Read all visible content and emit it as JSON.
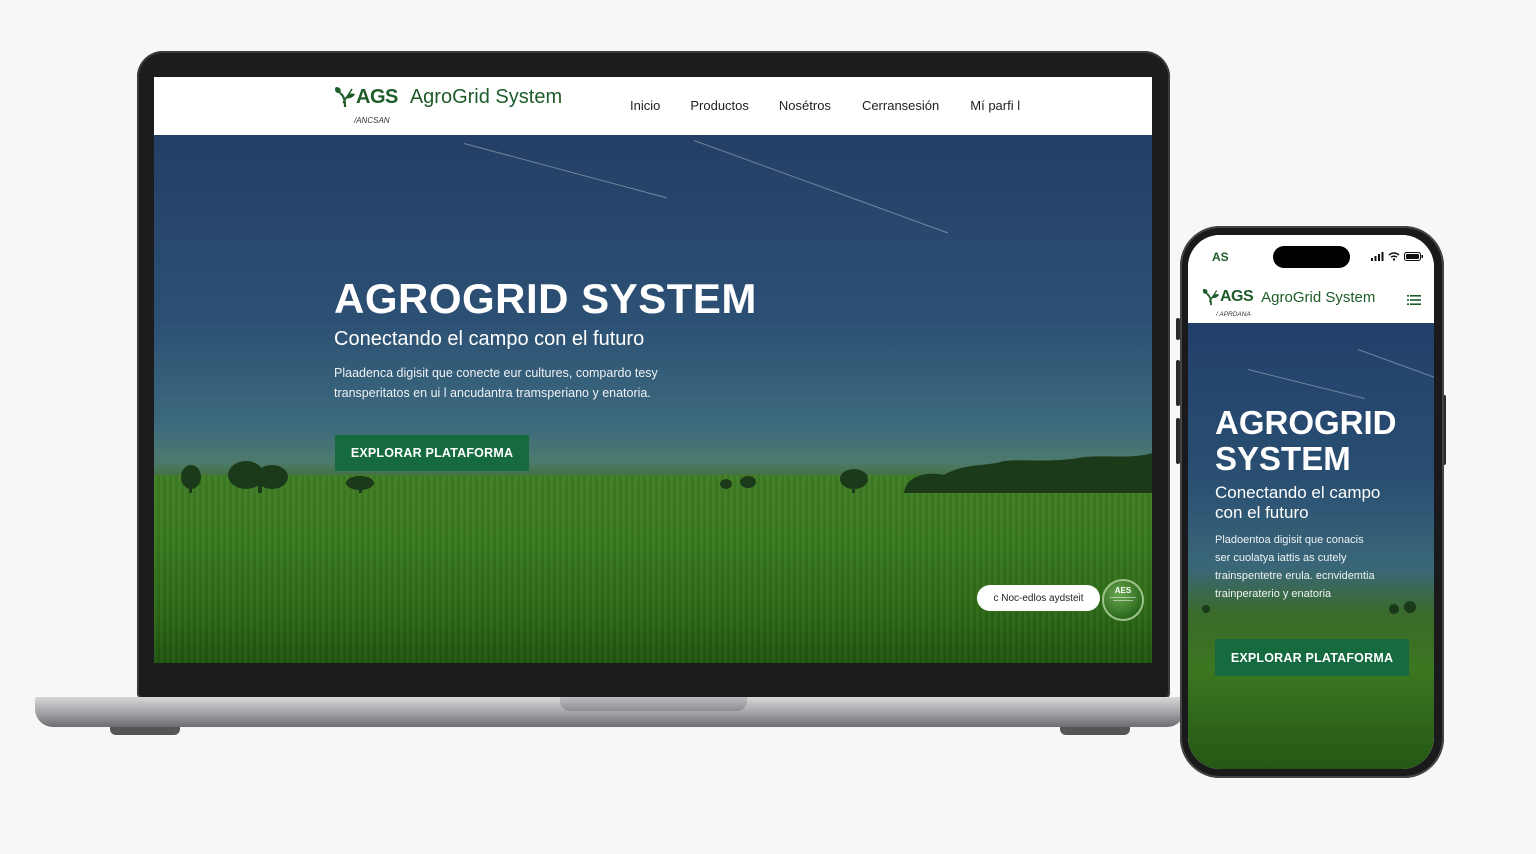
{
  "brand": {
    "abbr": "AGS",
    "name": "AgroGrid System",
    "tagline_desktop": "/ANCSAN",
    "tagline_mobile": "/ APRDANA"
  },
  "desktop": {
    "nav": [
      "Inicio",
      "Productos",
      "Nosétros",
      "Cerransesión",
      "Mí parfi l"
    ],
    "hero": {
      "title": "AGROGRID SYSTEM",
      "subtitle": "Conectando el campo con el futuro",
      "description_line1": "Plaadenca digisit que conecte eur cultures, compardo tesy",
      "description_line2": "transperitatos en ui l ancudantra tramsperiano y enatoria.",
      "cta": "EXPLORAR PLATAFORMA"
    },
    "chip": "c Noc-edlos aydsteit",
    "badge": "AES"
  },
  "mobile": {
    "status_left": "AS",
    "hero": {
      "title_line1": "AGROGRID",
      "title_line2": "SYSTEM",
      "subtitle_line1": "Conectando el campo",
      "subtitle_line2": "con el futuro",
      "description_line1": "Pladoentoa digisit que conacis",
      "description_line2": "ser cuolatya iattis as cutely",
      "description_line3": "trainspentetre erula. ecnvidemtia",
      "description_line4": "trainperaterio y enatoria",
      "cta": "EXPLORAR PLATAFORMA"
    }
  },
  "colors": {
    "brand_green": "#1e5c2a",
    "cta_green": "#156b3f"
  },
  "icons": {
    "logo": "leaf-sprout-icon",
    "menu": "hamburger-menu-icon",
    "signal": "cellular-signal-icon",
    "wifi": "wifi-icon",
    "battery": "battery-icon"
  }
}
